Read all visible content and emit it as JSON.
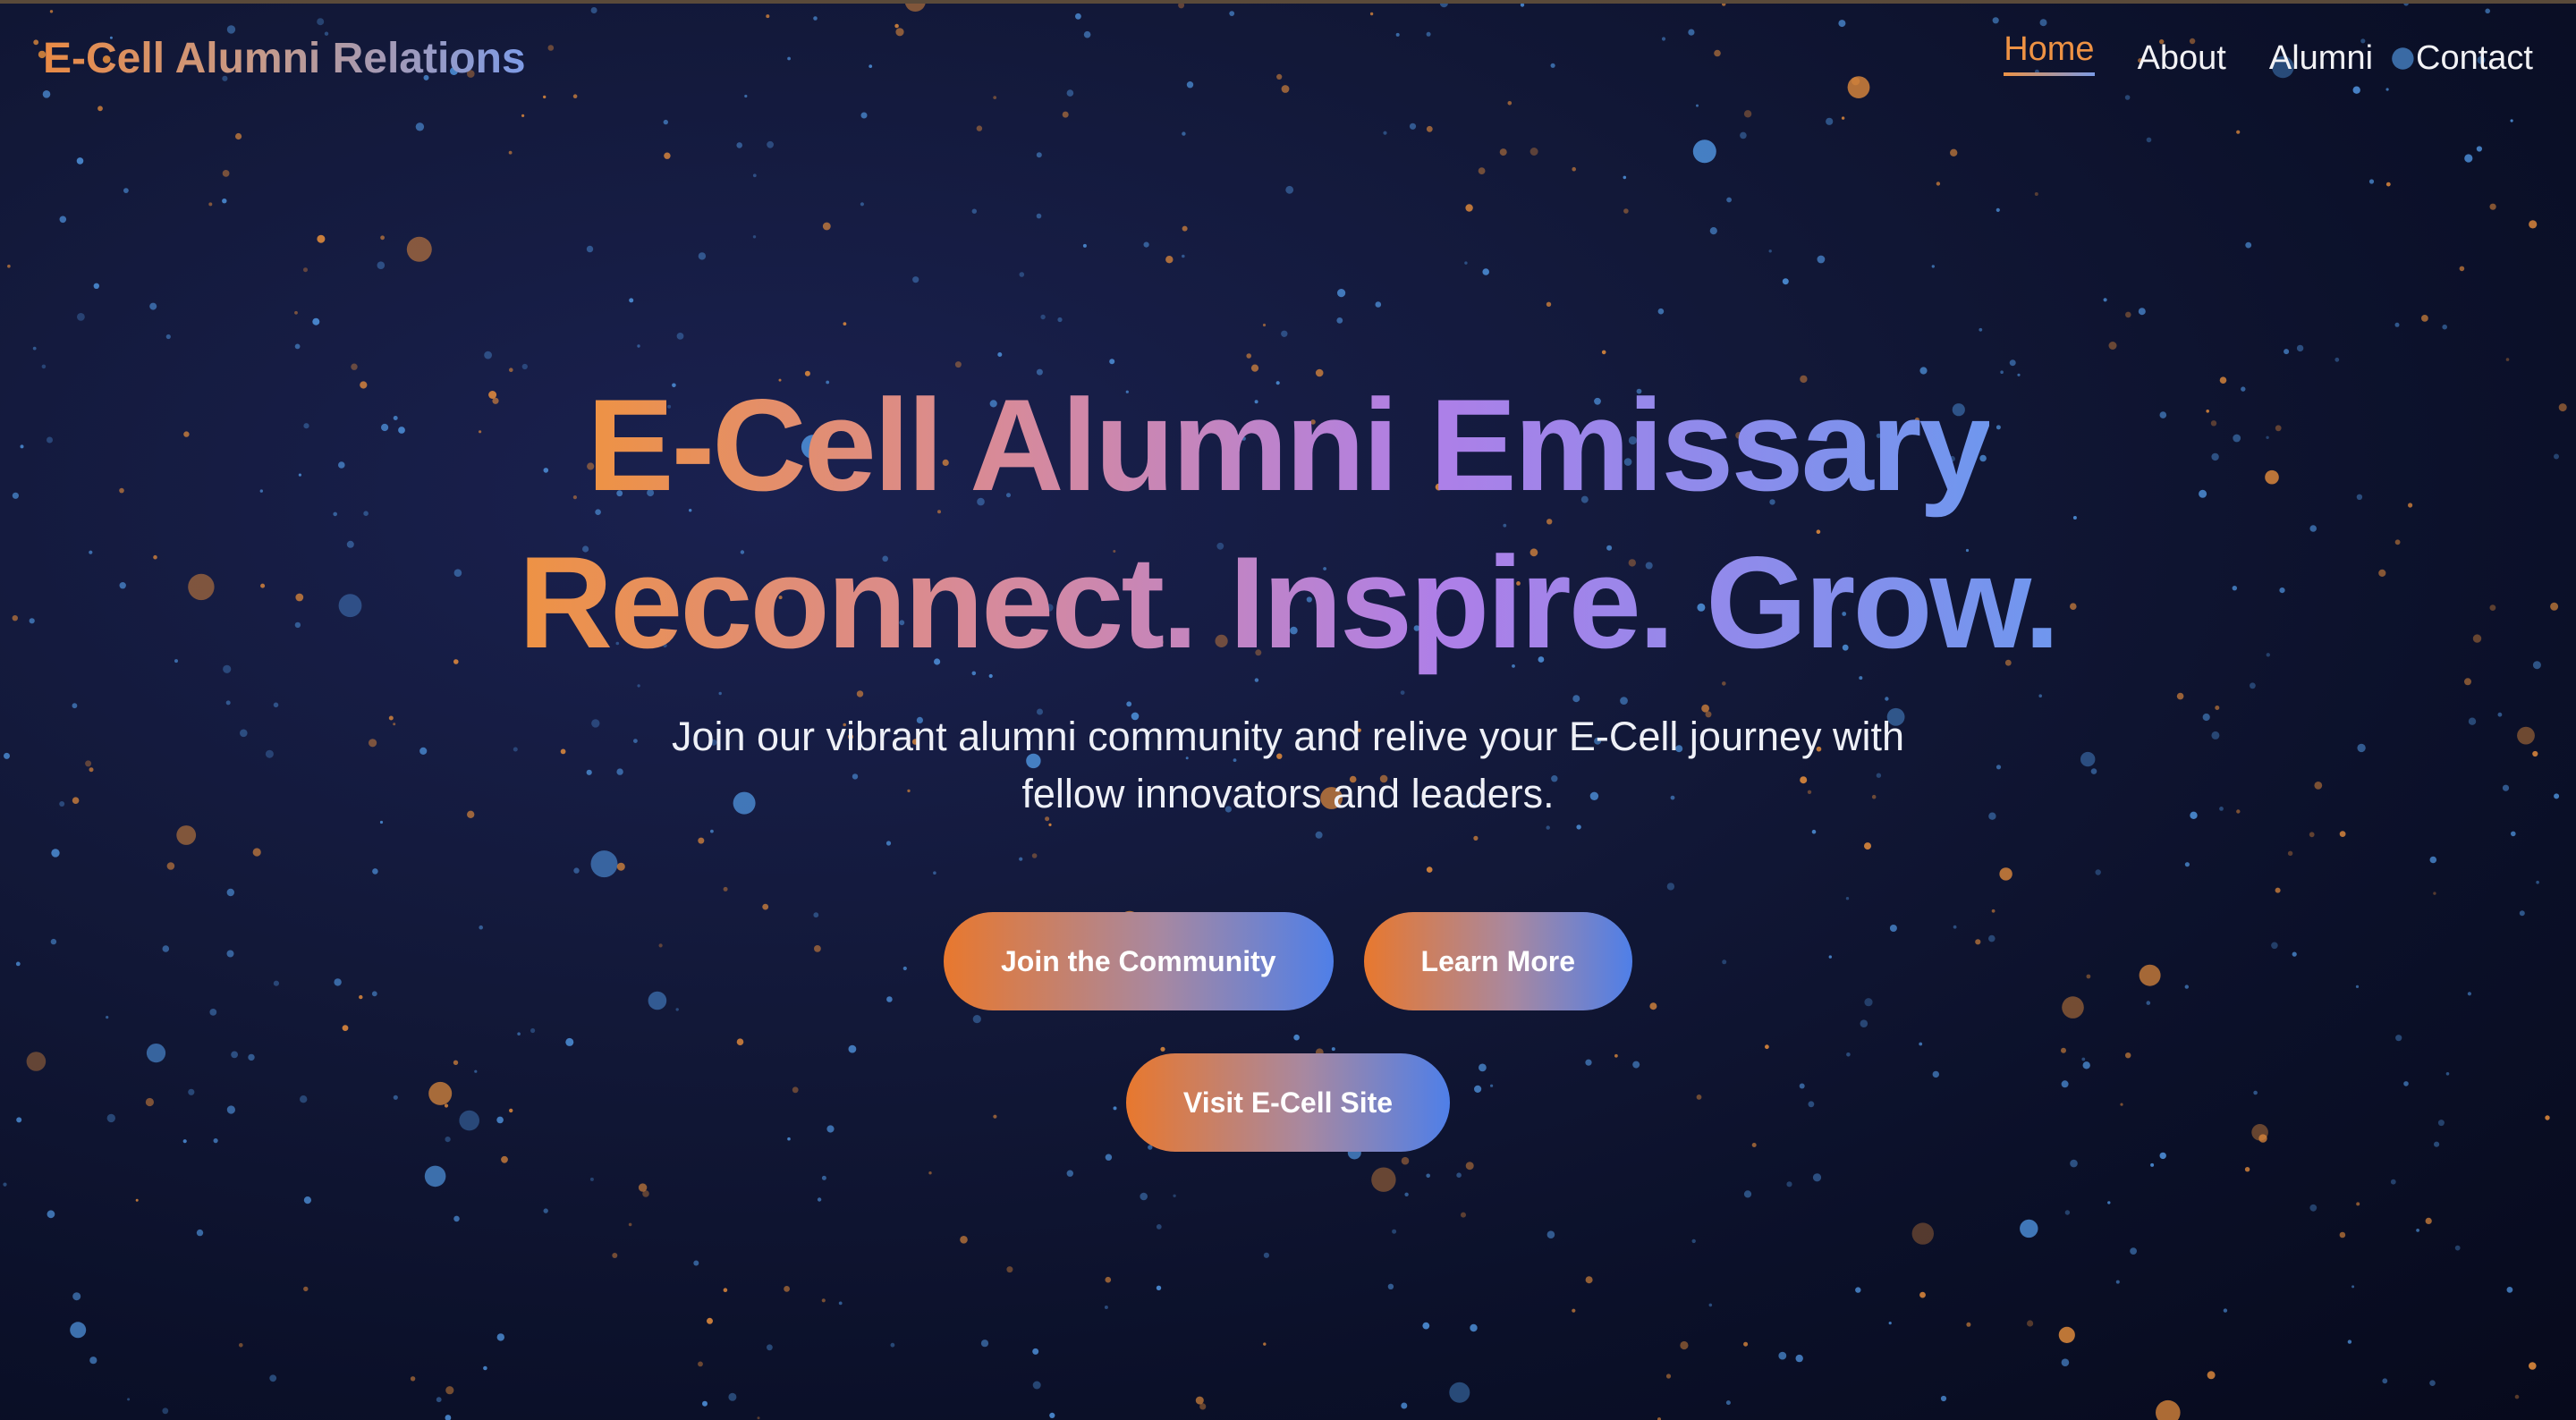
{
  "nav": {
    "brand": "E-Cell Alumni Relations",
    "links": [
      {
        "label": "Home",
        "active": true
      },
      {
        "label": "About",
        "active": false
      },
      {
        "label": "Alumni",
        "active": false
      },
      {
        "label": "Contact",
        "active": false
      }
    ]
  },
  "hero": {
    "title_line1": "E-Cell Alumni Emissary",
    "title_line2": "Reconnect. Inspire. Grow.",
    "subtitle": "Join our vibrant alumni community and relive your E-Cell journey with fellow innovators and leaders.",
    "buttons": {
      "join": "Join the Community",
      "learn": "Learn More",
      "visit": "Visit E-Cell Site"
    }
  },
  "colors": {
    "accent_orange": "#ee9244",
    "accent_purple": "#ae7fe8",
    "accent_blue": "#6f97ee",
    "background": "#0b1028",
    "star_blue": "#4d8fd8",
    "star_orange": "#e08a3c"
  }
}
